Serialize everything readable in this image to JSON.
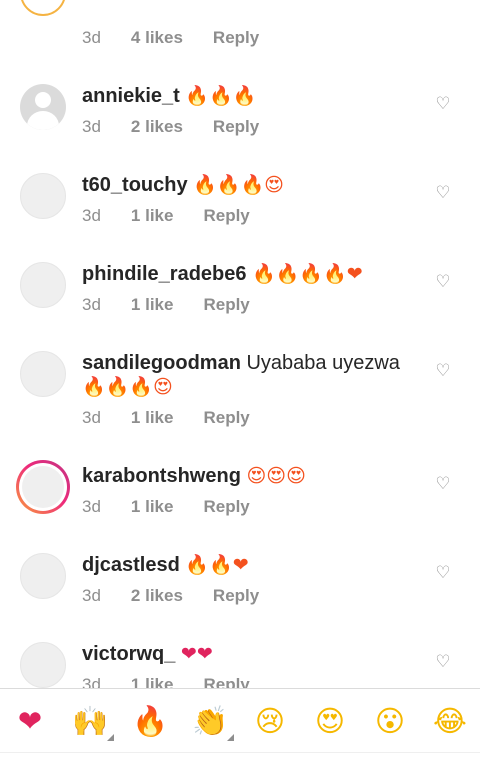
{
  "comments_top": {
    "time": "3d",
    "likes": "4 likes",
    "reply": "Reply"
  },
  "comments": [
    {
      "username": "anniekie_t",
      "text": "",
      "emojis": "🔥🔥🔥",
      "time": "3d",
      "likes": "2 likes",
      "reply": "Reply"
    },
    {
      "username": "t60_touchy",
      "text": "",
      "emojis": "🔥🔥🔥😍",
      "time": "3d",
      "likes": "1 like",
      "reply": "Reply"
    },
    {
      "username": "phindile_radebe6",
      "text": "",
      "emojis": "🔥🔥🔥🔥❤",
      "time": "3d",
      "likes": "1 like",
      "reply": "Reply"
    },
    {
      "username": "sandilegoodman",
      "text": "Uyababa uyezwa",
      "emojis": "🔥🔥🔥😍",
      "time": "3d",
      "likes": "1 like",
      "reply": "Reply"
    },
    {
      "username": "karabontshweng",
      "text": "",
      "emojis": "😍😍😍",
      "time": "3d",
      "likes": "1 like",
      "reply": "Reply"
    },
    {
      "username": "djcastlesd",
      "text": "",
      "emojis": "🔥🔥❤",
      "time": "3d",
      "likes": "2 likes",
      "reply": "Reply"
    },
    {
      "username": "victorwq_",
      "text": "",
      "emojis": "❤❤",
      "time": "3d",
      "likes": "1 like",
      "reply": "Reply"
    }
  ],
  "icons": {
    "like": "heart-outline-icon"
  },
  "emoji_bar": [
    "❤",
    "🙌",
    "🔥",
    "👏",
    "😢",
    "😍",
    "😮",
    "😂"
  ],
  "colors": {
    "meta": "#8e8e8e",
    "text": "#262626",
    "divider": "#dbdbdb"
  }
}
